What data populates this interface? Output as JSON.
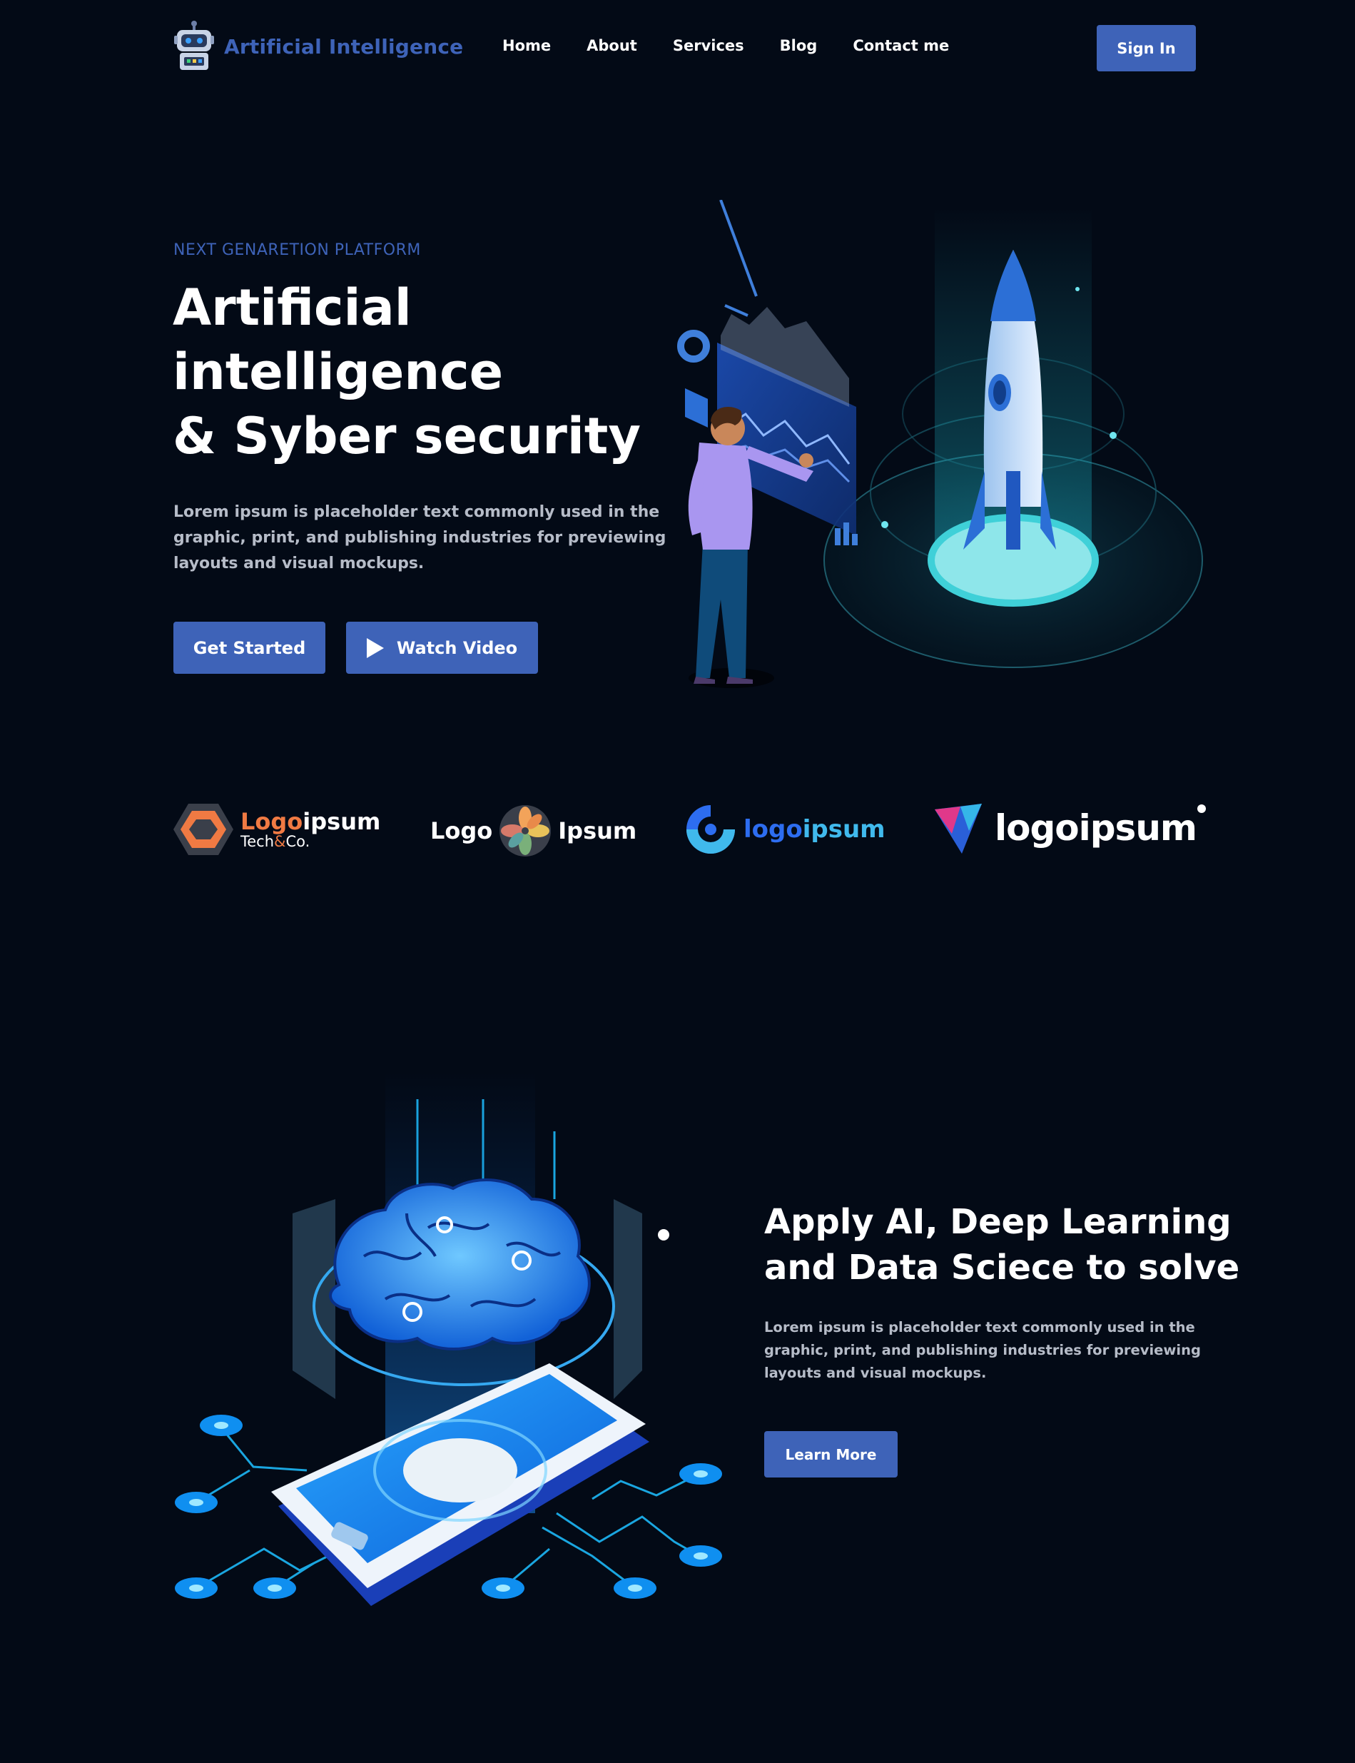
{
  "nav": {
    "brand": "Artificial Intelligence",
    "links": [
      "Home",
      "About",
      "Services",
      "Blog",
      "Contact me"
    ],
    "signin": "Sign In"
  },
  "hero": {
    "eyebrow": "NEXT GENARETION PLATFORM",
    "title_lines": [
      "Artificial",
      "intelligence",
      "& Syber security"
    ],
    "description": "Lorem ipsum is placeholder text commonly used in the graphic, print, and publishing industries for previewing layouts and visual mockups.",
    "cta_primary": "Get Started",
    "cta_secondary": "Watch Video"
  },
  "brands": {
    "b1_main_a": "Logo",
    "b1_main_b": "ipsum",
    "b1_sub_a": "Tech",
    "b1_sub_amp": "&",
    "b1_sub_b": "Co.",
    "b2_left": "Logo",
    "b2_right": "Ipsum",
    "b3_a": "logo",
    "b3_b": "ipsum",
    "b4": "logoipsum"
  },
  "section2": {
    "title_lines": [
      "Apply AI, Deep Learning",
      "and Data Sciece to solve"
    ],
    "description": "Lorem ipsum is placeholder text commonly used in the graphic, print, and publishing industries for previewing layouts and visual mockups.",
    "cta": "Learn More"
  },
  "colors": {
    "background": "#030a16",
    "accent": "#3e63b8",
    "muted_text": "#b6bcc8",
    "orange": "#f07a43",
    "cyan": "#40b9ec"
  }
}
